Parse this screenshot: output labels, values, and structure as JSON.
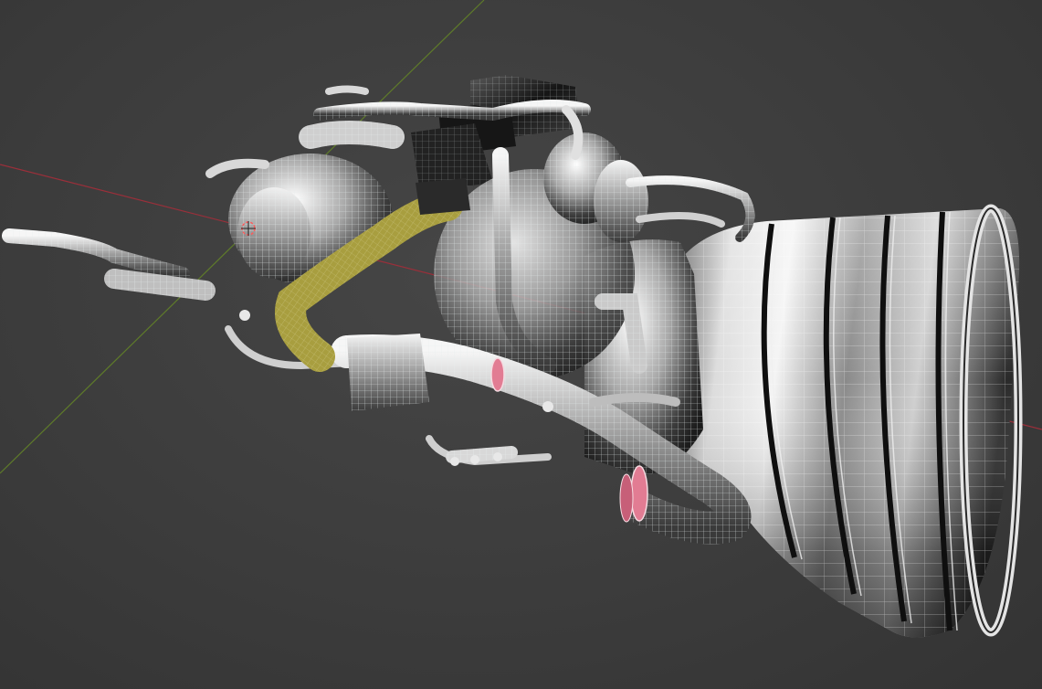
{
  "viewport": {
    "background_color": "#3d3d3d",
    "object": "rocket-engine",
    "display_mode": "wireframe-on-shaded",
    "selected_part": "fuel-duct"
  },
  "colors": {
    "x_axis": "#9a2f3a",
    "y_axis": "#5e7a2a",
    "wire": "#d9e6e6",
    "metal_dark": "#1e1e1e",
    "metal_light": "#f2f4f4",
    "selection_yellow": "#bdb24a",
    "flange_pink": "#e27c93",
    "origin_marker": "#ff5a5a"
  },
  "icons": [
    "origin-marker-icon"
  ]
}
